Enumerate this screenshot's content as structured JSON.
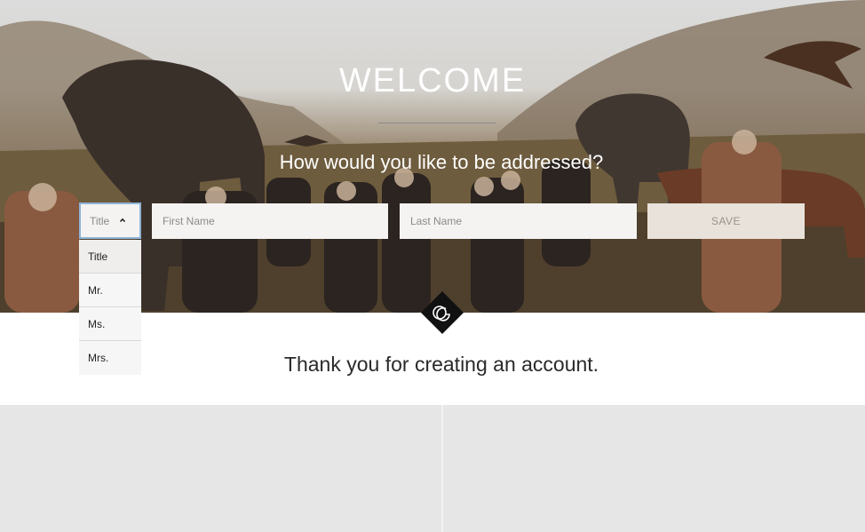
{
  "hero": {
    "heading": "WELCOME",
    "question": "How would you like to be addressed?"
  },
  "form": {
    "title_select": {
      "selected": "Title",
      "options": [
        "Title",
        "Mr.",
        "Ms.",
        "Mrs."
      ],
      "expanded": true
    },
    "first_name": {
      "placeholder": "First Name",
      "value": ""
    },
    "last_name": {
      "placeholder": "Last Name",
      "value": ""
    },
    "save_label": "SAVE"
  },
  "confirmation": {
    "message": "Thank you for creating an account."
  },
  "brand": {
    "logo_icon": "gg-monogram-icon"
  },
  "colors": {
    "accent_focus": "#8fb3d6",
    "save_bg": "#e8e2db",
    "field_bg": "#f4f3f2",
    "panel_bg": "#e6e6e6"
  }
}
